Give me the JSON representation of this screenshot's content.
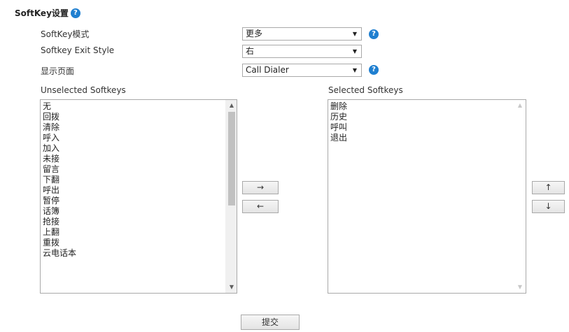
{
  "section": {
    "title": "SoftKey设置",
    "help_icon": "?"
  },
  "settings": [
    {
      "label": "SoftKey模式",
      "value": "更多",
      "has_help": true
    },
    {
      "label": "Softkey Exit Style",
      "value": "右",
      "has_help": false
    },
    {
      "label": "显示页面",
      "value": "Call Dialer",
      "has_help": true
    }
  ],
  "help_glyph": "?",
  "dropdown_arrow": "▼",
  "unselected": {
    "label": "Unselected Softkeys",
    "items": [
      "无",
      "回拨",
      "清除",
      "呼入",
      "加入",
      "未接",
      "留言",
      "下翻",
      "呼出",
      "暂停",
      "话簿",
      "抢接",
      "上翻",
      "重拨",
      "云电话本"
    ]
  },
  "selected": {
    "label": "Selected Softkeys",
    "items": [
      "删除",
      "历史",
      "呼叫",
      "退出"
    ]
  },
  "buttons": {
    "move_right": "→",
    "move_left": "←",
    "move_up": "↑",
    "move_down": "↓",
    "submit": "提交"
  },
  "scroll_glyphs": {
    "up": "▲",
    "down": "▼"
  }
}
